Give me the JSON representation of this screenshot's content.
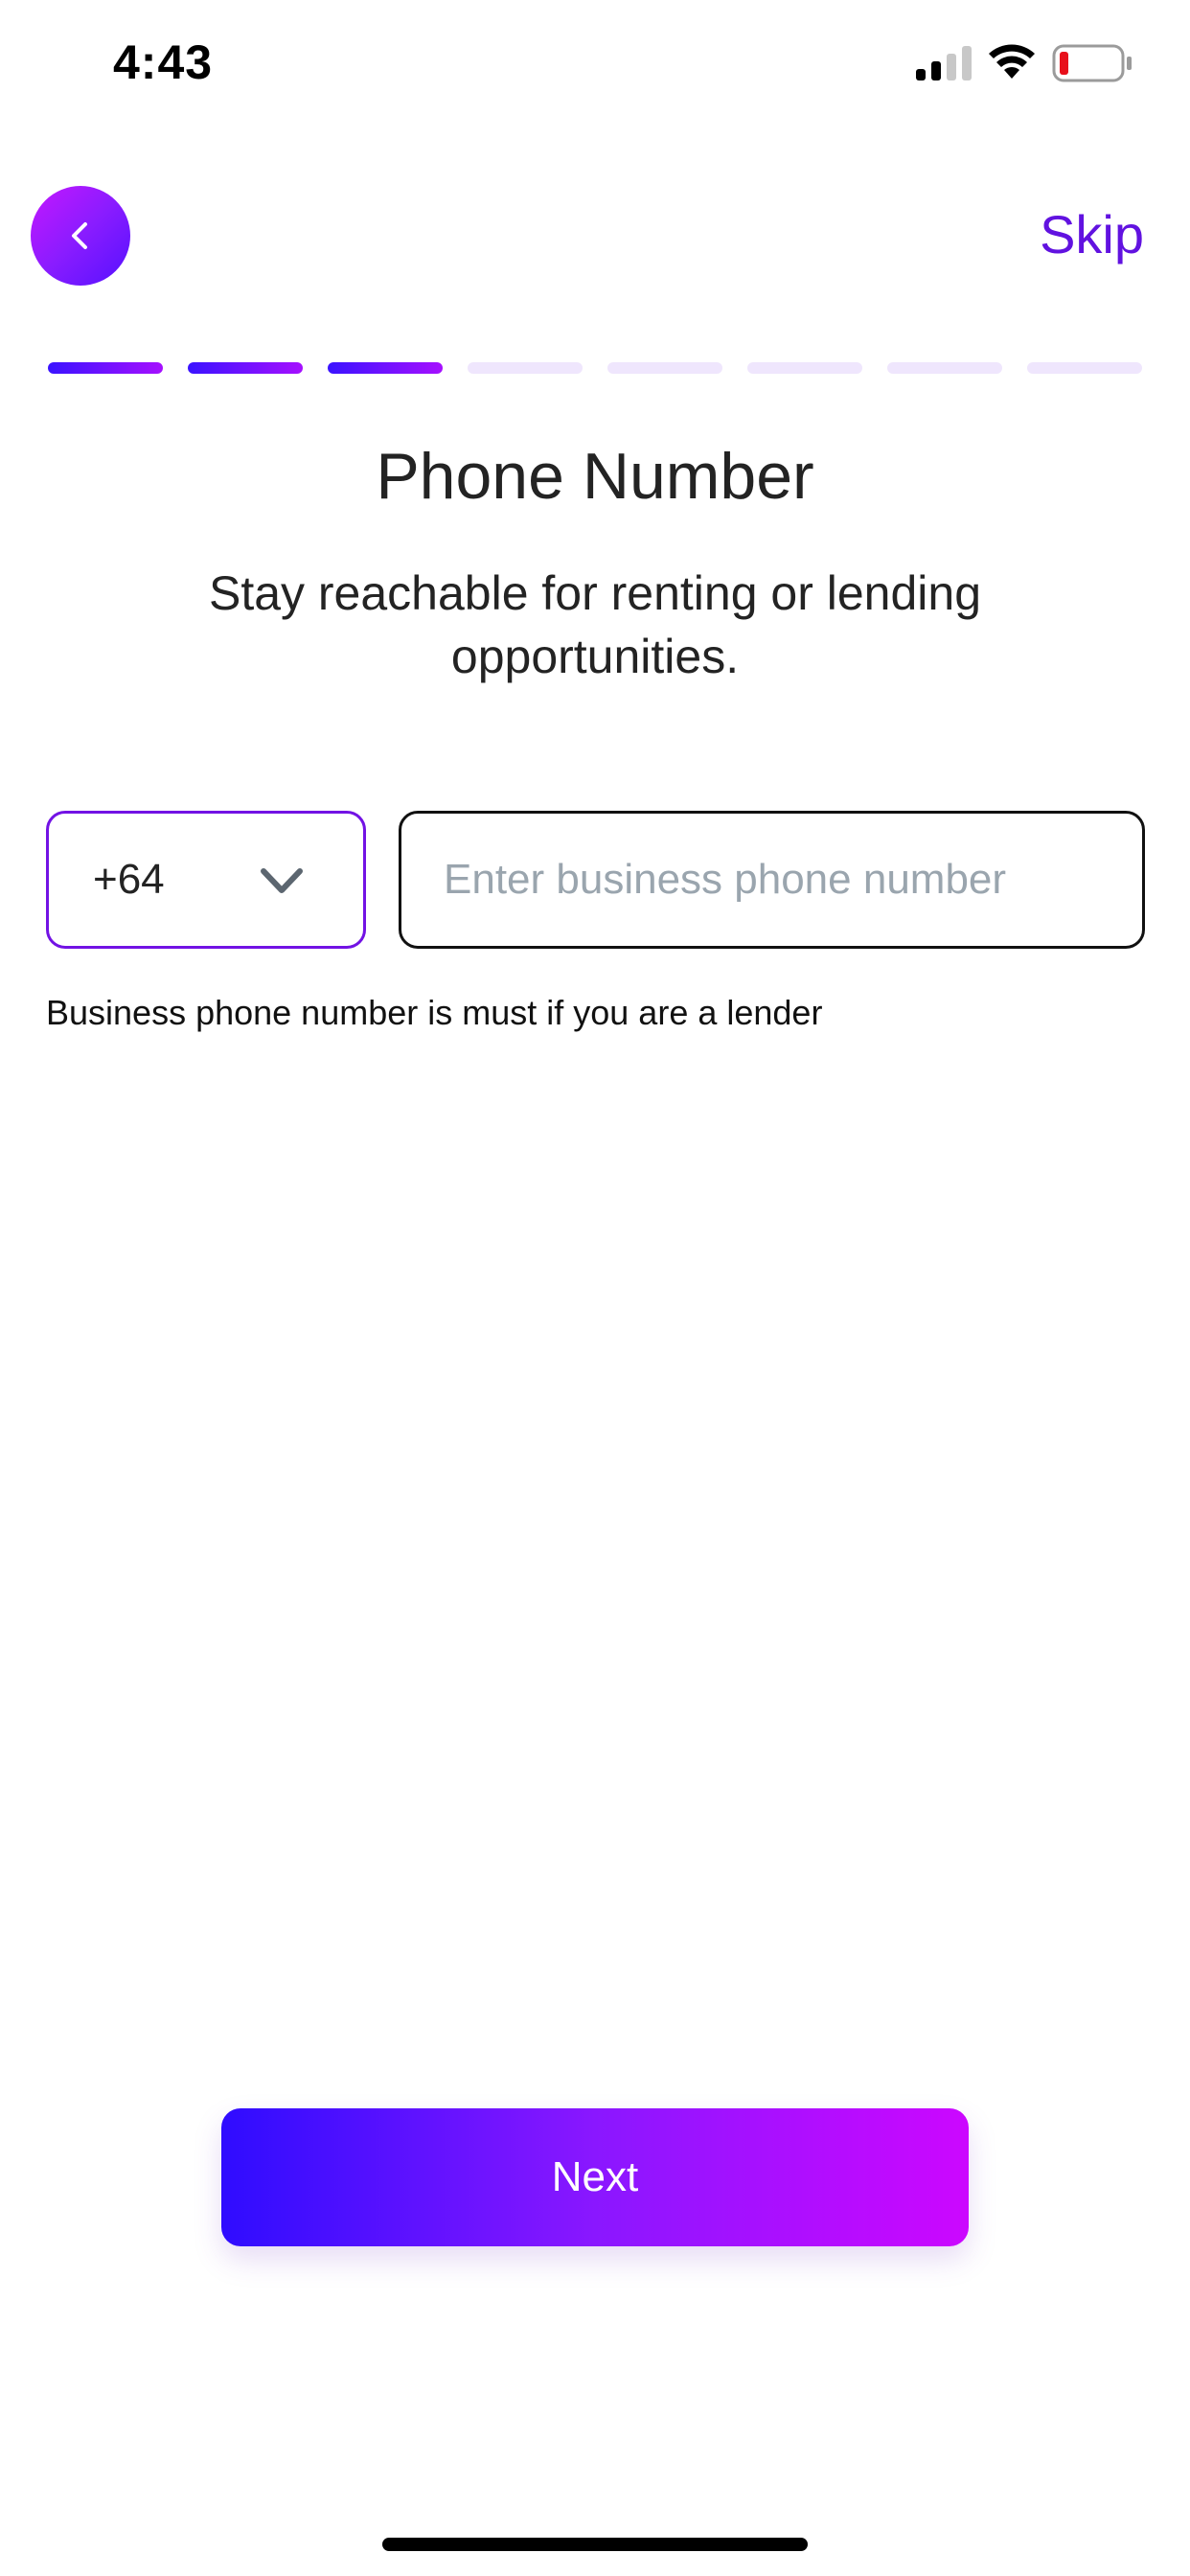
{
  "status_bar": {
    "time": "4:43",
    "icons": [
      "signal-icon",
      "wifi-icon",
      "battery-icon"
    ],
    "battery_color": "#e8101b"
  },
  "nav": {
    "back_icon": "chevron-left-icon",
    "skip_label": "Skip"
  },
  "progress": {
    "total_steps": 8,
    "completed_steps": 3
  },
  "main": {
    "title": "Phone Number",
    "subtitle": "Stay reachable for renting or lending opportunities.",
    "country_code": "+64",
    "phone_placeholder": "Enter business phone number",
    "phone_value": "",
    "helper_text": "Business phone number is must if you are a lender"
  },
  "footer": {
    "next_label": "Next"
  },
  "colors": {
    "accent": "#6112e0",
    "gradient_start": "#2f0cff",
    "gradient_end": "#cc07ff",
    "progress_inactive": "#efe6fd"
  }
}
